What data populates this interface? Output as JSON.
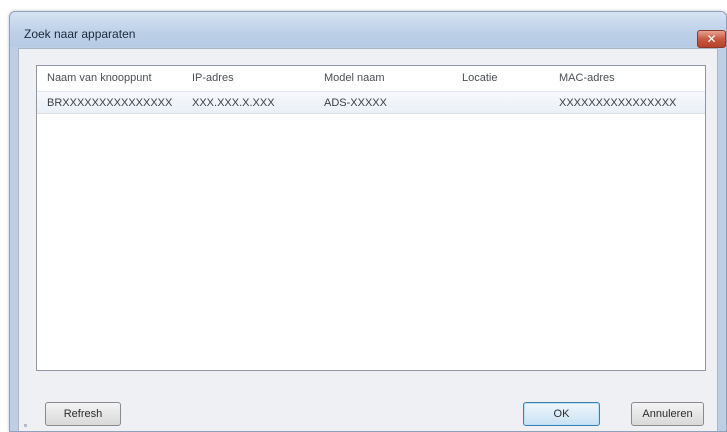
{
  "window": {
    "title": "Zoek naar apparaten",
    "close_icon": "close-icon"
  },
  "table": {
    "columns": [
      "Naam van knooppunt",
      "IP-adres",
      "Model naam",
      "Locatie",
      "MAC-adres"
    ],
    "rows": [
      [
        "BRXXXXXXXXXXXXXXX",
        "XXX.XXX.X.XXX",
        "ADS-XXXXX",
        "",
        "XXXXXXXXXXXXXXXX"
      ]
    ]
  },
  "buttons": {
    "refresh": "Refresh",
    "ok": "OK",
    "cancel": "Annuleren"
  },
  "colors": {
    "titlebar": "#bcd0e8",
    "close_button": "#c75a43",
    "dialog_background": "#eef0f3",
    "default_button_border": "#3c7fb1"
  }
}
